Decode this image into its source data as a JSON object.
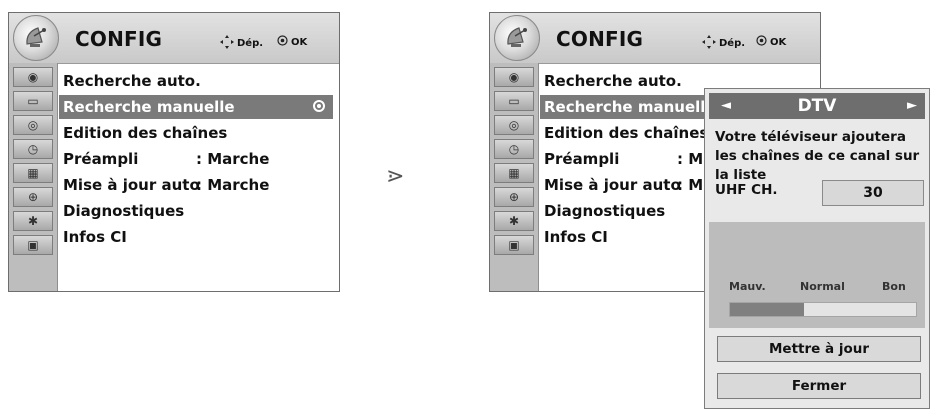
{
  "left_menu": {
    "title": "CONFIG",
    "hint_move": "Dép.",
    "hint_ok": "OK",
    "items": [
      {
        "label": "Recherche auto."
      },
      {
        "label": "Recherche manuelle"
      },
      {
        "label": "Edition des chaînes"
      },
      {
        "label": "Préampli",
        "value": ": Marche"
      },
      {
        "label": "Mise à jour auto",
        "value": ": Marche"
      },
      {
        "label": "Diagnostiques"
      },
      {
        "label": "Infos CI"
      }
    ],
    "selected_index": 1
  },
  "arrow": "⋗",
  "right_menu": {
    "title": "CONFIG",
    "hint_move": "Dép.",
    "hint_ok": "OK",
    "items": [
      {
        "label": "Recherche auto."
      },
      {
        "label": "Recherche manuelle"
      },
      {
        "label": "Edition des chaînes"
      },
      {
        "label": "Préampli",
        "value": ": M"
      },
      {
        "label": "Mise à jour auto",
        "value": ": M"
      },
      {
        "label": "Diagnostiques"
      },
      {
        "label": "Infos CI"
      }
    ],
    "selected_index": 1
  },
  "popup": {
    "title": "DTV",
    "left_arrow": "◄",
    "right_arrow": "►",
    "message": "Votre téléviseur ajoutera les chaînes de ce canal sur la liste",
    "channel_label": "UHF CH.",
    "channel_value": "30",
    "signal_labels": [
      "Mauv.",
      "Normal",
      "Bon"
    ],
    "signal_level": 0.4,
    "update_button": "Mettre à jour",
    "close_button": "Fermer"
  },
  "icons": [
    "globe-icon",
    "tv-icon",
    "disc-icon",
    "clock-icon",
    "calendar-icon",
    "lock-icon",
    "star-icon",
    "photo-icon"
  ],
  "colors": {
    "header": "#d0d0d0",
    "selection": "#7a7a7a",
    "icon_column": "#bdbdbd",
    "popup_title": "#6e6e6e"
  }
}
